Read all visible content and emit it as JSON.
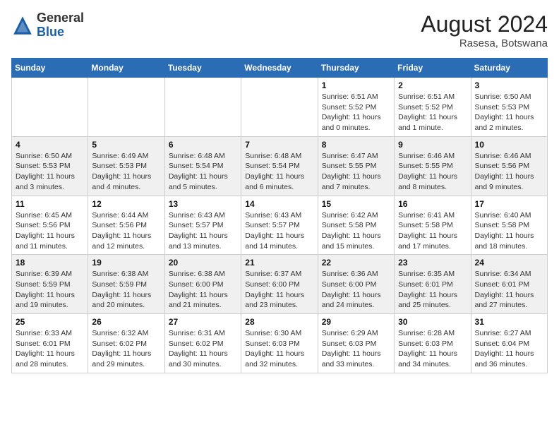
{
  "header": {
    "logo_general": "General",
    "logo_blue": "Blue",
    "month_year": "August 2024",
    "location": "Rasesa, Botswana"
  },
  "days_of_week": [
    "Sunday",
    "Monday",
    "Tuesday",
    "Wednesday",
    "Thursday",
    "Friday",
    "Saturday"
  ],
  "weeks": [
    [
      {
        "day": "",
        "info": ""
      },
      {
        "day": "",
        "info": ""
      },
      {
        "day": "",
        "info": ""
      },
      {
        "day": "",
        "info": ""
      },
      {
        "day": "1",
        "info": "Sunrise: 6:51 AM\nSunset: 5:52 PM\nDaylight: 11 hours and 0 minutes."
      },
      {
        "day": "2",
        "info": "Sunrise: 6:51 AM\nSunset: 5:52 PM\nDaylight: 11 hours and 1 minute."
      },
      {
        "day": "3",
        "info": "Sunrise: 6:50 AM\nSunset: 5:53 PM\nDaylight: 11 hours and 2 minutes."
      }
    ],
    [
      {
        "day": "4",
        "info": "Sunrise: 6:50 AM\nSunset: 5:53 PM\nDaylight: 11 hours and 3 minutes."
      },
      {
        "day": "5",
        "info": "Sunrise: 6:49 AM\nSunset: 5:53 PM\nDaylight: 11 hours and 4 minutes."
      },
      {
        "day": "6",
        "info": "Sunrise: 6:48 AM\nSunset: 5:54 PM\nDaylight: 11 hours and 5 minutes."
      },
      {
        "day": "7",
        "info": "Sunrise: 6:48 AM\nSunset: 5:54 PM\nDaylight: 11 hours and 6 minutes."
      },
      {
        "day": "8",
        "info": "Sunrise: 6:47 AM\nSunset: 5:55 PM\nDaylight: 11 hours and 7 minutes."
      },
      {
        "day": "9",
        "info": "Sunrise: 6:46 AM\nSunset: 5:55 PM\nDaylight: 11 hours and 8 minutes."
      },
      {
        "day": "10",
        "info": "Sunrise: 6:46 AM\nSunset: 5:56 PM\nDaylight: 11 hours and 9 minutes."
      }
    ],
    [
      {
        "day": "11",
        "info": "Sunrise: 6:45 AM\nSunset: 5:56 PM\nDaylight: 11 hours and 11 minutes."
      },
      {
        "day": "12",
        "info": "Sunrise: 6:44 AM\nSunset: 5:56 PM\nDaylight: 11 hours and 12 minutes."
      },
      {
        "day": "13",
        "info": "Sunrise: 6:43 AM\nSunset: 5:57 PM\nDaylight: 11 hours and 13 minutes."
      },
      {
        "day": "14",
        "info": "Sunrise: 6:43 AM\nSunset: 5:57 PM\nDaylight: 11 hours and 14 minutes."
      },
      {
        "day": "15",
        "info": "Sunrise: 6:42 AM\nSunset: 5:58 PM\nDaylight: 11 hours and 15 minutes."
      },
      {
        "day": "16",
        "info": "Sunrise: 6:41 AM\nSunset: 5:58 PM\nDaylight: 11 hours and 17 minutes."
      },
      {
        "day": "17",
        "info": "Sunrise: 6:40 AM\nSunset: 5:58 PM\nDaylight: 11 hours and 18 minutes."
      }
    ],
    [
      {
        "day": "18",
        "info": "Sunrise: 6:39 AM\nSunset: 5:59 PM\nDaylight: 11 hours and 19 minutes."
      },
      {
        "day": "19",
        "info": "Sunrise: 6:38 AM\nSunset: 5:59 PM\nDaylight: 11 hours and 20 minutes."
      },
      {
        "day": "20",
        "info": "Sunrise: 6:38 AM\nSunset: 6:00 PM\nDaylight: 11 hours and 21 minutes."
      },
      {
        "day": "21",
        "info": "Sunrise: 6:37 AM\nSunset: 6:00 PM\nDaylight: 11 hours and 23 minutes."
      },
      {
        "day": "22",
        "info": "Sunrise: 6:36 AM\nSunset: 6:00 PM\nDaylight: 11 hours and 24 minutes."
      },
      {
        "day": "23",
        "info": "Sunrise: 6:35 AM\nSunset: 6:01 PM\nDaylight: 11 hours and 25 minutes."
      },
      {
        "day": "24",
        "info": "Sunrise: 6:34 AM\nSunset: 6:01 PM\nDaylight: 11 hours and 27 minutes."
      }
    ],
    [
      {
        "day": "25",
        "info": "Sunrise: 6:33 AM\nSunset: 6:01 PM\nDaylight: 11 hours and 28 minutes."
      },
      {
        "day": "26",
        "info": "Sunrise: 6:32 AM\nSunset: 6:02 PM\nDaylight: 11 hours and 29 minutes."
      },
      {
        "day": "27",
        "info": "Sunrise: 6:31 AM\nSunset: 6:02 PM\nDaylight: 11 hours and 30 minutes."
      },
      {
        "day": "28",
        "info": "Sunrise: 6:30 AM\nSunset: 6:03 PM\nDaylight: 11 hours and 32 minutes."
      },
      {
        "day": "29",
        "info": "Sunrise: 6:29 AM\nSunset: 6:03 PM\nDaylight: 11 hours and 33 minutes."
      },
      {
        "day": "30",
        "info": "Sunrise: 6:28 AM\nSunset: 6:03 PM\nDaylight: 11 hours and 34 minutes."
      },
      {
        "day": "31",
        "info": "Sunrise: 6:27 AM\nSunset: 6:04 PM\nDaylight: 11 hours and 36 minutes."
      }
    ]
  ]
}
